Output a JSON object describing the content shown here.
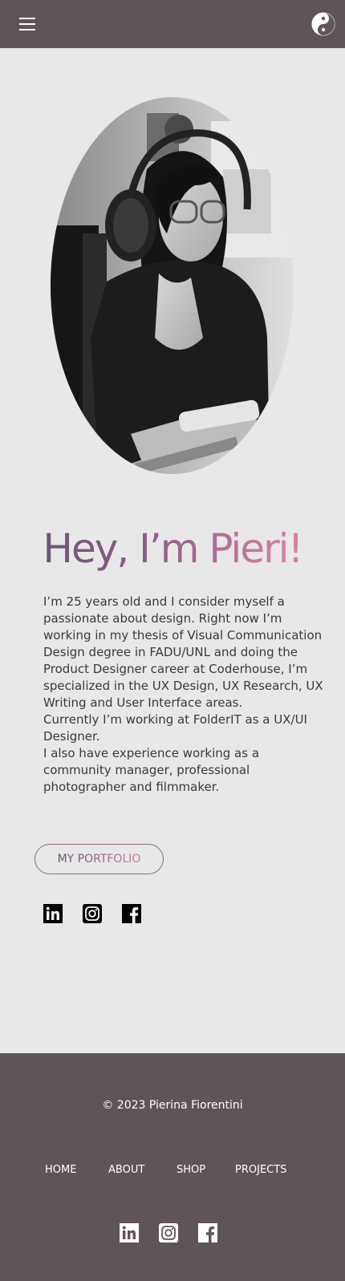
{
  "header": {
    "menu_icon": "hamburger-menu-icon",
    "theme_icon": "yin-yang-icon"
  },
  "hero": {
    "photo": "portrait-photo",
    "title": "Hey, I’m Pieri!"
  },
  "bio": {
    "paragraphs": [
      "I’m 25 years old and I consider myself a passionate about design. Right now I’m working in my thesis of Visual Communication Design degree in FADU/UNL and doing the Product Designer career at Coderhouse, I’m specialized in the UX Design, UX Research, UX Writing and User Interface areas.",
      "Currently I’m working at FolderIT as a UX/UI Designer.",
      "I also have experience working as a community manager, professional photographer and filmmaker."
    ]
  },
  "cta": {
    "portfolio_label": "MY PORTFOLIO"
  },
  "social_icons": [
    "linkedin-icon",
    "instagram-icon",
    "facebook-icon"
  ],
  "footer": {
    "copyright": "© 2023 Pierina Fiorentini",
    "nav": [
      "HOME",
      "ABOUT",
      "SHOP",
      "PROJECTS"
    ]
  },
  "colors": {
    "bar": "#5f5459",
    "background": "#e8e8e8",
    "gradient_start": "#5e5470",
    "gradient_end": "#f58cb2"
  }
}
